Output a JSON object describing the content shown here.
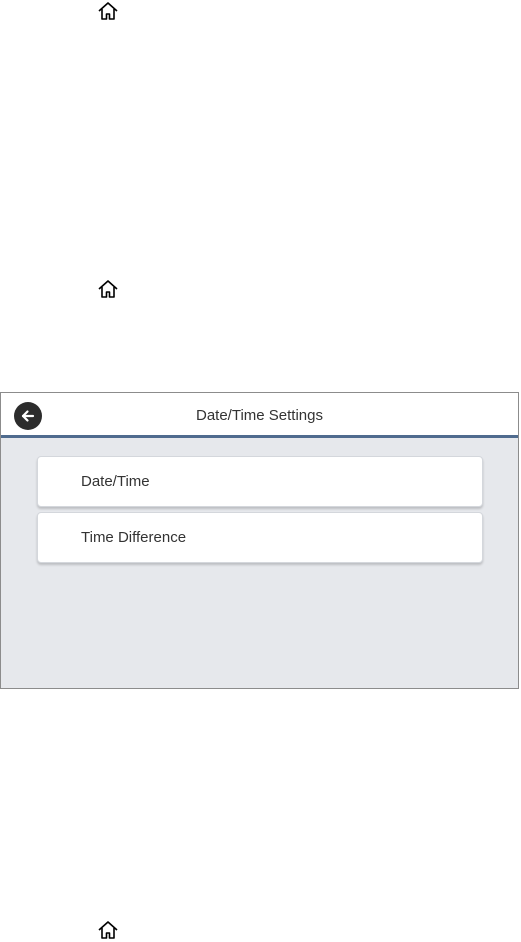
{
  "icons": {
    "home": "home-icon",
    "back": "arrow-left-icon"
  },
  "panel": {
    "title": "Date/Time Settings",
    "menu_items": [
      {
        "label": "Date/Time"
      },
      {
        "label": "Time Difference"
      }
    ]
  },
  "colors": {
    "header_accent": "#4f6b8e",
    "panel_background": "#e6e8ec",
    "back_button": "#2c2c2c"
  }
}
